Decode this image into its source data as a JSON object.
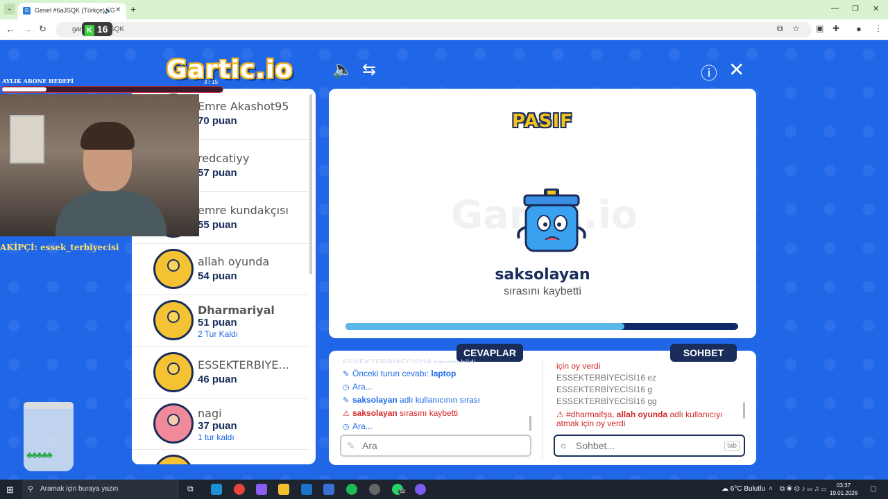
{
  "browser": {
    "tab_title": "Genel #6aJSQK (Türkçe) - G",
    "url": "gartic.io/6aJSQK",
    "badge_count": "16",
    "new_tab_label": "+",
    "window_controls": [
      "—",
      "❐",
      "✕"
    ]
  },
  "game": {
    "logo": "Gartic.io",
    "icons": [
      "sound-icon",
      "share-icon",
      "info-icon",
      "close-icon"
    ],
    "players": [
      {
        "name": "Emre Akashot95",
        "score": "70 puan",
        "turns": "",
        "bold": false,
        "avatar": "boy"
      },
      {
        "name": "redcatiyy",
        "score": "57 puan",
        "turns": "",
        "bold": false,
        "avatar": "boy"
      },
      {
        "name": "emre kundakçısı",
        "score": "55 puan",
        "turns": "",
        "bold": false,
        "avatar": "boy"
      },
      {
        "name": "allah oyunda",
        "score": "54 puan",
        "turns": "",
        "bold": false,
        "avatar": "boy"
      },
      {
        "name": "Dharmariyal",
        "score": "51 puan",
        "turns": "2 Tur Kaldı",
        "bold": true,
        "avatar": "boy"
      },
      {
        "name": "ESSEKTERBIYE...",
        "score": "46 puan",
        "turns": "",
        "bold": false,
        "avatar": "boy"
      },
      {
        "name": "nagi",
        "score": "37 puan",
        "turns": "1 tur kaldı",
        "bold": false,
        "avatar": "girl"
      }
    ],
    "status_title": "PASIF",
    "watermark": "Gartic.io",
    "turn_user": "saksolayan",
    "turn_message": "sırasını kaybetti",
    "progress": 0.71,
    "answers_tab": "CEVAPLAR",
    "chat_tab": "SOHBET",
    "answers": [
      {
        "icon": "✎",
        "pre": "Önceki turun cevabı: ",
        "bold": "laptop",
        "post": "",
        "red": false
      },
      {
        "icon": "◷",
        "pre": "Ara...",
        "bold": "",
        "post": "",
        "red": false
      },
      {
        "icon": "✎",
        "pre": "",
        "bold": "saksolayan",
        "post": " adlı kullanıcının sırası",
        "red": false
      },
      {
        "icon": "⚠",
        "pre": "",
        "bold": "saksolayan",
        "post": " sırasını kaybetti",
        "red": true
      },
      {
        "icon": "◷",
        "pre": "Ara...",
        "bold": "",
        "post": "",
        "red": false
      }
    ],
    "answers_cut_top": "ESSEKTERBIYECISI16 cevabı bildi",
    "chat": [
      {
        "text": "için oy verdi",
        "red": true
      },
      {
        "text": "ESSEKTERBİYECİSİ16 ez",
        "red": false
      },
      {
        "text": "ESSEKTERBİYECİSİ16 g",
        "red": false
      },
      {
        "text": "ESSEKTERBİYECİSİ16 gg",
        "red": false
      }
    ],
    "chat_warning": {
      "pre": "#dharmaifşa, ",
      "bold": "allah oyunda",
      "post": " adlı kullanıcıyı",
      "line2": "atmak için oy verdi"
    },
    "answer_placeholder": "Ara",
    "chat_placeholder": "Sohbet...",
    "tab_key": "tab"
  },
  "overlay": {
    "goal_label": "AYLIK ABONE HEDEFİ",
    "goal_count": "3 / 15",
    "goal_progress": 0.2,
    "follower": "AKİPÇİ: essek_terbiyecisi"
  },
  "taskbar": {
    "search_placeholder": "Aramak için buraya yazın",
    "weather": "6°C Bulutlu",
    "time": "03:37",
    "date": "19.01.2026",
    "whatsapp_badge": "52"
  },
  "colors": {
    "background": "#2067e8",
    "navy": "#1a2d5a",
    "accent": "#f2c21f",
    "progress": "#5ab7ea",
    "warning": "#d12828"
  }
}
